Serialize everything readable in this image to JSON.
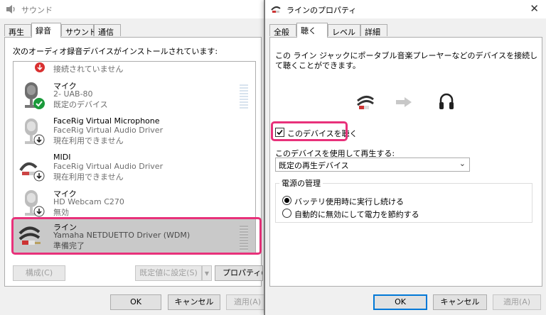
{
  "sound_dialog": {
    "title": "サウンド",
    "tabs": [
      "再生",
      "録音",
      "サウンド",
      "通信"
    ],
    "active_tab": "録音",
    "instruction": "次のオーディオ録音デバイスがインストールされています:",
    "devices": [
      {
        "name": "",
        "line2": "接続されていません",
        "line3": "",
        "status": "disconnected"
      },
      {
        "name": "マイク",
        "line2": "2- UAB-80",
        "line3": "既定のデバイス",
        "status": "default"
      },
      {
        "name": "FaceRig Virtual Microphone",
        "line2": "FaceRig Virtual Audio Driver",
        "line3": "現在利用できません",
        "status": "unavailable"
      },
      {
        "name": "MIDI",
        "line2": "FaceRig Virtual Audio Driver",
        "line3": "現在利用できません",
        "status": "unavailable"
      },
      {
        "name": "マイク",
        "line2": "HD Webcam C270",
        "line3": "無効",
        "status": "disabled"
      },
      {
        "name": "ライン",
        "line2": "Yamaha NETDUETTO Driver (WDM)",
        "line3": "準備完了",
        "status": "ready"
      }
    ],
    "configure_label": "構成(C)",
    "set_default_label": "既定値に設定(S)",
    "properties_label": "プロパティ(P)",
    "ok_label": "OK",
    "cancel_label": "キャンセル",
    "apply_label": "適用(A)"
  },
  "line_properties": {
    "title": "ラインのプロパティ",
    "tabs": [
      "全般",
      "聴く",
      "レベル",
      "詳細"
    ],
    "active_tab": "聴く",
    "description": "この ライン ジャックにポータブル音楽プレーヤーなどのデバイスを接続して聴くことができます。",
    "listen_checkbox_label": "このデバイスを聴く",
    "listen_checked": true,
    "playback_label": "このデバイスを使用して再生する:",
    "playback_selected": "既定の再生デバイス",
    "power_group_label": "電源の管理",
    "power_options": [
      "バッテリ使用時に実行し続ける",
      "自動的に無効にして電力を節約する"
    ],
    "power_selected_index": 0,
    "ok_label": "OK",
    "cancel_label": "キャンセル",
    "apply_label": "適用(A)"
  },
  "colors": {
    "highlight": "#e8317a",
    "accent": "#0078d7",
    "check_green": "#1a9a3a",
    "arrow_red": "#d93030"
  }
}
